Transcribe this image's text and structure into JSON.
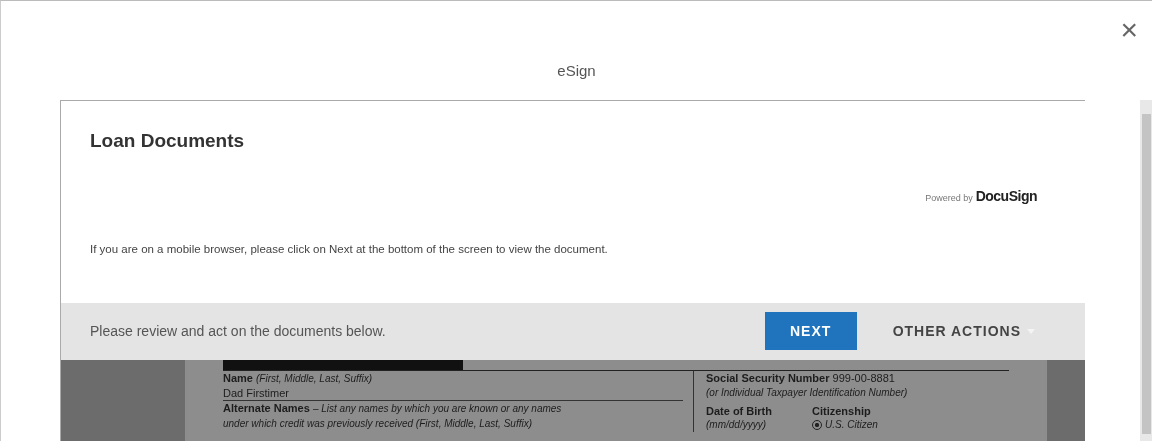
{
  "dialog": {
    "title": "eSign",
    "close": "×"
  },
  "panel": {
    "title": "Loan Documents",
    "powered_by": "Powered by",
    "brand": "DocuSign",
    "notice": "If you are on a mobile browser, please click on Next at the bottom of the screen to view the document."
  },
  "action_bar": {
    "message": "Please review and act on the documents below.",
    "primary_button": "NEXT",
    "secondary_button": "OTHER ACTIONS"
  },
  "document": {
    "left": [
      {
        "label": "Name",
        "hint": "(First, Middle, Last, Suffix)"
      },
      {
        "value": "Dad Firstimer"
      },
      {
        "label": "Alternate Names",
        "hint": "– List any names by which you are known or any names"
      },
      {
        "hint": "under which credit was previously received (First, Middle, Last, Suffix)"
      }
    ],
    "right": [
      {
        "label": "Social Security Number",
        "value": "999-00-8881"
      },
      {
        "hint": "(or Individual Taxpayer Identification Number)"
      }
    ],
    "dob": {
      "label": "Date of Birth",
      "hint": "(mm/dd/yyyy)"
    },
    "citizenship": {
      "label": "Citizenship",
      "option": "U.S. Citizen",
      "selected": true
    }
  }
}
